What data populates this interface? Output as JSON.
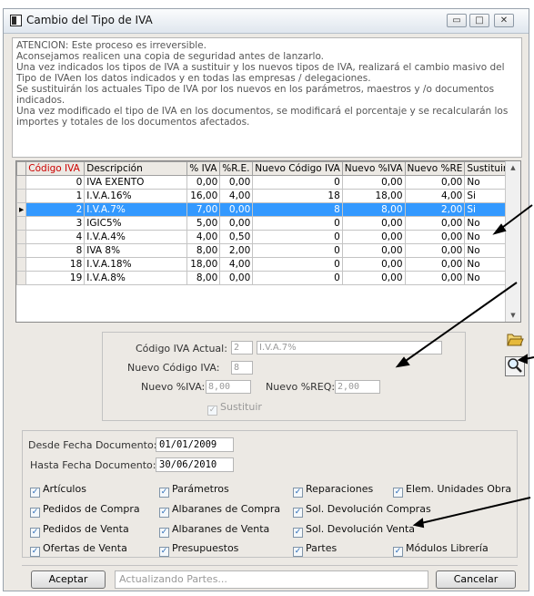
{
  "window": {
    "title": "Cambio del Tipo de IVA",
    "buttons": {
      "minimize": "▭",
      "maximize": "□",
      "close": "✕"
    }
  },
  "info": {
    "lines": [
      "ATENCION: Este proceso es irreversible.",
      "Aconsejamos realicen una copia de seguridad antes de lanzarlo.",
      "Una vez indicados los tipos de IVA a sustituir y los nuevos tipos de IVA, realizará el cambio masivo del Tipo de IVAen los datos indicados y en todas las empresas / delegaciones.",
      "Se sustituirán los actuales Tipo de IVA por los nuevos en los parámetros, maestros y /o documentos indicados.",
      "Una vez modificado el tipo de IVA en los documentos, se modificará el porcentaje y se recalcularán los importes y totales de los documentos afectados."
    ]
  },
  "grid": {
    "columns": [
      "Código IVA",
      "Descripción",
      "% IVA",
      "%R.E.",
      "Nuevo Código IVA",
      "Nuevo %IVA",
      "Nuevo %RE",
      "Sustituir"
    ],
    "rows": [
      {
        "codigo": "0",
        "desc": "IVA EXENTO",
        "iva": "0,00",
        "re": "0,00",
        "nuevo_codigo": "0",
        "nuevo_iva": "0,00",
        "nuevo_re": "0,00",
        "sustituir": "No"
      },
      {
        "codigo": "1",
        "desc": "I.V.A.16%",
        "iva": "16,00",
        "re": "4,00",
        "nuevo_codigo": "18",
        "nuevo_iva": "18,00",
        "nuevo_re": "4,00",
        "sustituir": "Si"
      },
      {
        "codigo": "2",
        "desc": "I.V.A.7%",
        "iva": "7,00",
        "re": "0,00",
        "nuevo_codigo": "8",
        "nuevo_iva": "8,00",
        "nuevo_re": "2,00",
        "sustituir": "Si"
      },
      {
        "codigo": "3",
        "desc": "IGIC5%",
        "iva": "5,00",
        "re": "0,00",
        "nuevo_codigo": "0",
        "nuevo_iva": "0,00",
        "nuevo_re": "0,00",
        "sustituir": "No"
      },
      {
        "codigo": "4",
        "desc": "I.V.A.4%",
        "iva": "4,00",
        "re": "0,50",
        "nuevo_codigo": "0",
        "nuevo_iva": "0,00",
        "nuevo_re": "0,00",
        "sustituir": "No"
      },
      {
        "codigo": "8",
        "desc": "IVA 8%",
        "iva": "8,00",
        "re": "2,00",
        "nuevo_codigo": "0",
        "nuevo_iva": "0,00",
        "nuevo_re": "0,00",
        "sustituir": "No"
      },
      {
        "codigo": "18",
        "desc": "I.V.A.18%",
        "iva": "18,00",
        "re": "4,00",
        "nuevo_codigo": "0",
        "nuevo_iva": "0,00",
        "nuevo_re": "0,00",
        "sustituir": "No"
      },
      {
        "codigo": "19",
        "desc": "I.V.A.8%",
        "iva": "8,00",
        "re": "0,00",
        "nuevo_codigo": "0",
        "nuevo_iva": "0,00",
        "nuevo_re": "0,00",
        "sustituir": "No"
      }
    ],
    "selected_row_index": 2
  },
  "detail": {
    "codigo_actual_label": "Código IVA Actual:",
    "codigo_actual_value": "2",
    "descripcion_actual_value": "I.V.A.7%",
    "nuevo_codigo_label": "Nuevo Código IVA:",
    "nuevo_codigo_value": "8",
    "nuevo_iva_label": "Nuevo %IVA:",
    "nuevo_iva_value": "8,00",
    "nuevo_req_label": "Nuevo %REQ:",
    "nuevo_req_value": "2,00",
    "sustituir_label": "Sustituir",
    "sustituir_checked": true
  },
  "side_icons": {
    "open": "folder-open-icon",
    "search": "magnifier-icon"
  },
  "filters": {
    "desde_label": "Desde Fecha Documento:",
    "desde_value": "01/01/2009",
    "hasta_label": "Hasta Fecha Documento:",
    "hasta_value": "30/06/2010",
    "checks": {
      "articulos": "Artículos",
      "parametros": "Parámetros",
      "reparaciones": "Reparaciones",
      "elem_unidades_obra": "Elem. Unidades Obra",
      "pedidos_compra": "Pedidos de Compra",
      "albaranes_compra": "Albaranes de Compra",
      "sol_devolucion_compras": "Sol. Devolución Compras",
      "pedidos_venta": "Pedidos de Venta",
      "albaranes_venta": "Albaranes de Venta",
      "sol_devolucion_venta": "Sol. Devolución Venta",
      "ofertas_venta": "Ofertas de Venta",
      "presupuestos": "Presupuestos",
      "partes": "Partes",
      "modulos_libreria": "Módulos Librería"
    },
    "all_checked": true
  },
  "footer": {
    "aceptar": "Aceptar",
    "status": "Actualizando Partes...",
    "cancelar": "Cancelar"
  },
  "colors": {
    "selection": "#3399ff",
    "header_code": "#cc0000"
  }
}
